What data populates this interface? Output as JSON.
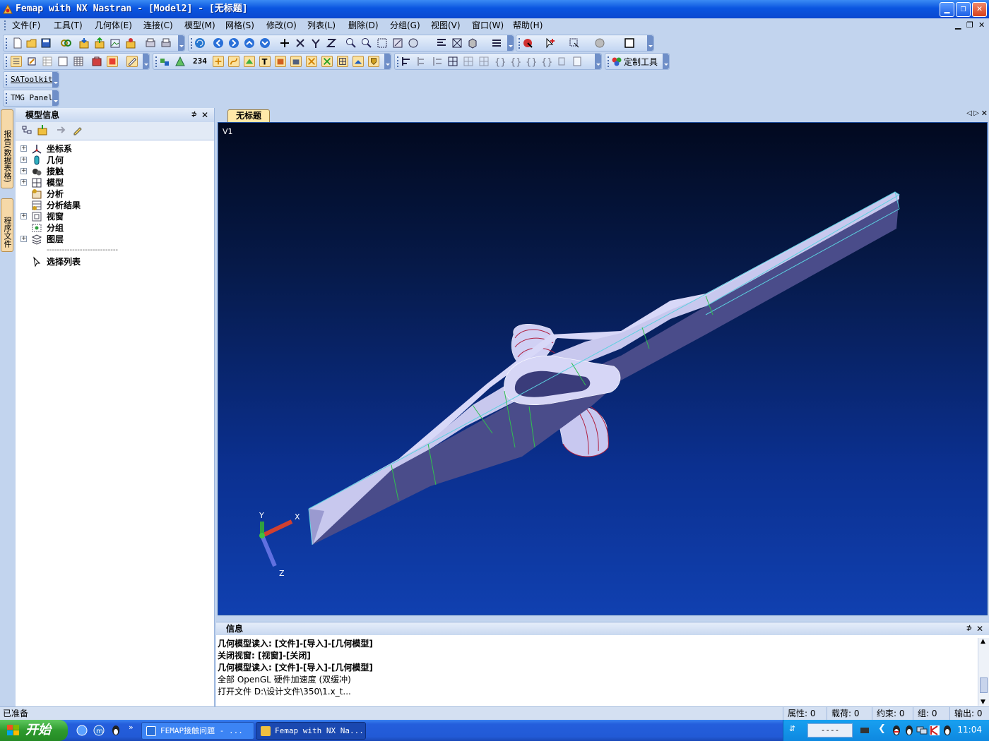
{
  "window": {
    "title": "Femap with NX Nastran - [Model2] - [无标题]",
    "controls": [
      "minimize",
      "restore",
      "close"
    ]
  },
  "menubar": {
    "items": [
      "文件(F)",
      "工具(T)",
      "几何体(E)",
      "连接(C)",
      "模型(M)",
      "网格(S)",
      "修改(O)",
      "列表(L)",
      "删除(D)",
      "分组(G)",
      "视图(V)",
      "窗口(W)",
      "帮助(H)"
    ]
  },
  "toolbars": {
    "custom_tools_label": "定制工具",
    "satoolkit_label": "SAToolkit",
    "tmg_panel_label": "TMG Panel",
    "counter_label": "234"
  },
  "side_tabs": [
    "报告(数据表格)",
    "程序文件"
  ],
  "model_info": {
    "title": "模型信息",
    "pin": "⊅",
    "close": "✕",
    "tree": [
      {
        "label": "坐标系",
        "expandable": true,
        "icon": "axis-icon"
      },
      {
        "label": "几何",
        "expandable": true,
        "icon": "geometry-icon"
      },
      {
        "label": "接触",
        "expandable": true,
        "icon": "contact-icon"
      },
      {
        "label": "模型",
        "expandable": true,
        "icon": "model-grid-icon"
      },
      {
        "label": "分析",
        "expandable": false,
        "icon": "analysis-icon"
      },
      {
        "label": "分析结果",
        "expandable": false,
        "icon": "results-icon"
      },
      {
        "label": "视窗",
        "expandable": true,
        "icon": "view-icon"
      },
      {
        "label": "分组",
        "expandable": false,
        "icon": "group-icon"
      },
      {
        "label": "图层",
        "expandable": true,
        "icon": "layers-icon"
      }
    ],
    "separator": "----------------------------",
    "select_list": "选择列表"
  },
  "view": {
    "tab_label": "无标题",
    "viewport_label": "V1",
    "triad": {
      "x": "X",
      "y": "Y",
      "z": "Z"
    }
  },
  "info_panel": {
    "title": "信息",
    "lines": [
      {
        "text": "几何模型读入: [文件]-[导入]-[几何模型]",
        "bold": true
      },
      {
        "text": "关闭视窗: [视窗]-[关闭]",
        "bold": true
      },
      {
        "text": "几何模型读入: [文件]-[导入]-[几何模型]",
        "bold": true
      },
      {
        "text": "全部 OpenGL 硬件加速度 (双缓冲)",
        "bold": false
      },
      {
        "text": "打开文件 D:\\设计文件\\350\\1.x_t...",
        "bold": false
      }
    ]
  },
  "statusbar": {
    "left": "已准备",
    "cells": [
      "属性: 0",
      "载荷: 0",
      "约束: 0",
      "组: 0",
      "输出: 0"
    ]
  },
  "taskbar": {
    "start_label": "开始",
    "tasks": [
      {
        "label": "FEMAP接触问题 - ...",
        "active": false
      },
      {
        "label": "Femap with NX Na...",
        "active": true
      }
    ],
    "ime_label": "----",
    "clock": "11:04"
  }
}
